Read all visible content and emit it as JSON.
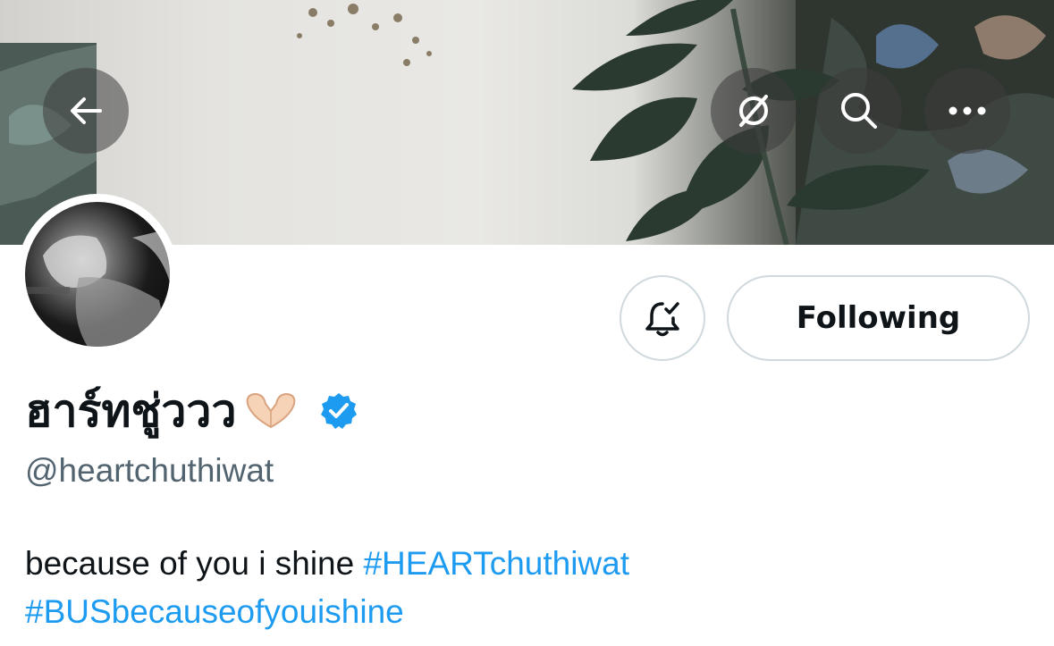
{
  "header": {
    "back_icon": "arrow-left-icon",
    "hide_icon": "hide-slash-icon",
    "search_icon": "search-icon",
    "more_icon": "more-horizontal-icon"
  },
  "profile": {
    "display_name": "ฮาร์ทชู่ววว",
    "name_emoji_icon": "heart-hands-icon",
    "verified_icon": "verified-badge-icon",
    "handle": "@heartchuthiwat",
    "bio_text": "because of you i shine ",
    "bio_hashtags": [
      "#HEARTchuthiwat",
      "#BUSbecauseofyouishine"
    ]
  },
  "actions": {
    "notifications_icon": "bell-check-icon",
    "following_label": "Following"
  },
  "colors": {
    "link": "#1d9bf0",
    "secondary_text": "#536471",
    "border": "#cfd9de",
    "verified": "#1d9bf0"
  }
}
